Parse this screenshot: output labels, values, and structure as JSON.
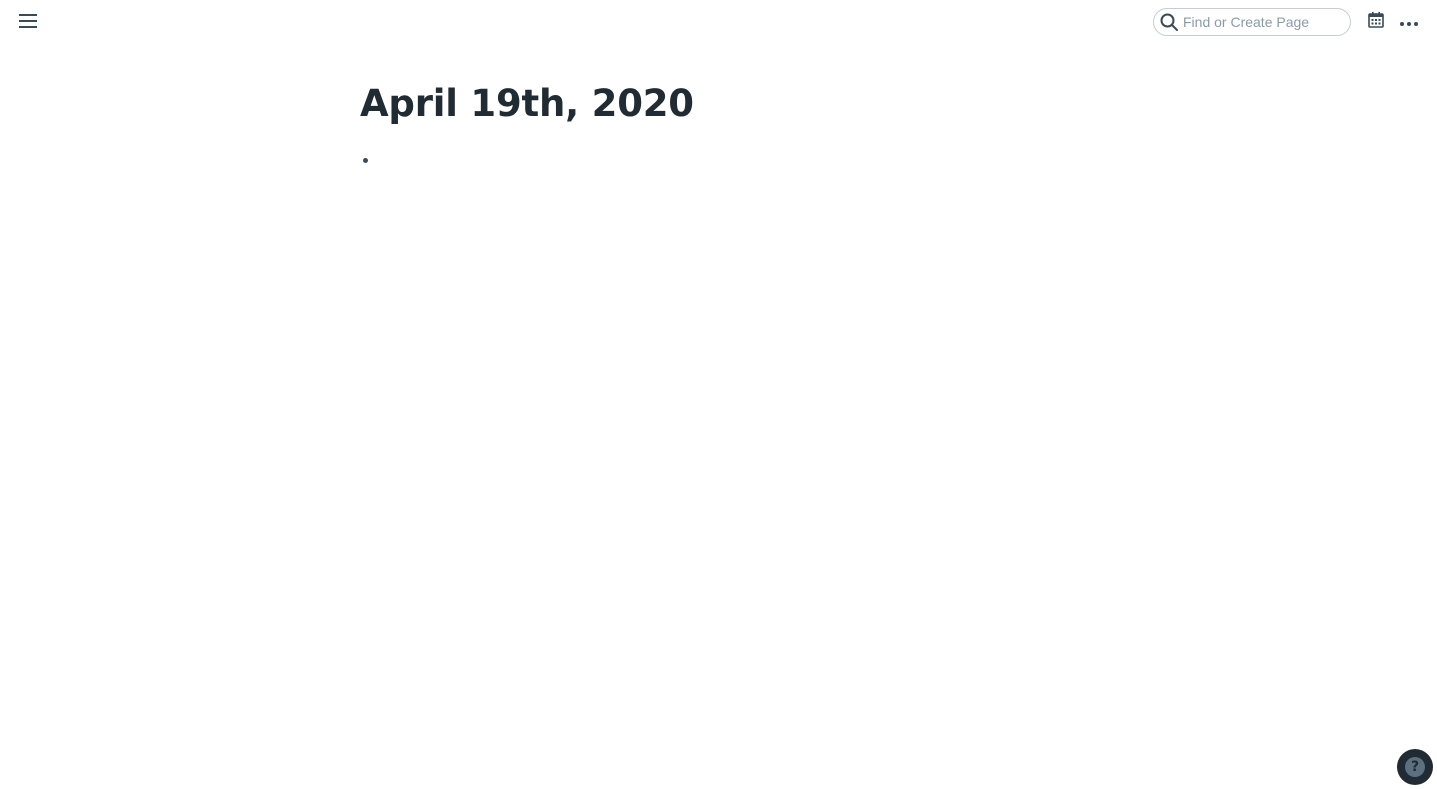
{
  "topbar": {
    "menu_icon": "hamburger-menu-icon",
    "search": {
      "placeholder": "Find or Create Page",
      "value": "",
      "icon": "search-icon"
    },
    "calendar_icon": "calendar-icon",
    "more_icon": "more-horizontal-icon"
  },
  "page": {
    "title": "April 19th, 2020",
    "blocks": [
      {
        "text": ""
      }
    ]
  },
  "help": {
    "icon": "help-icon",
    "glyph": "?"
  },
  "colors": {
    "text": "#202b33",
    "muted": "#5c7080",
    "border": "#c5ccd3",
    "help_bg": "#202b33"
  }
}
